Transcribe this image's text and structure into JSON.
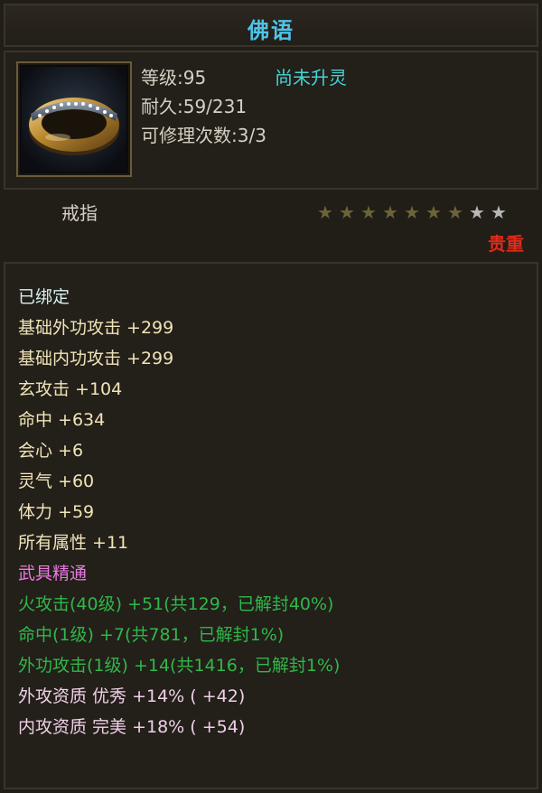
{
  "title": "佛语",
  "item": {
    "level": "等级:95",
    "durability": "耐久:59/231",
    "repairs": "可修理次数:3/3",
    "spirit_status": "尚未升灵",
    "type": "戒指",
    "rarity": "贵重",
    "stars_total": 9,
    "stars_filled": 7,
    "icon": "ring-icon"
  },
  "colors": {
    "title": "#4fc3e8",
    "spirit_status": "#44d4d8",
    "rarity": "#e02a1a",
    "star_filled": "#6b6438",
    "star_empty": "#b8b8b8",
    "attr": "#f0e4b8",
    "special": "#e87ae0",
    "mastery": "#2fb84a"
  },
  "attributes": {
    "bound": "已绑定",
    "lines": [
      "基础外功攻击 +299",
      "基础内功攻击 +299",
      "玄攻击 +104",
      "命中 +634",
      "会心 +6",
      "灵气 +60",
      "体力 +59",
      "所有属性 +11"
    ],
    "special_title": "武具精通",
    "mastery": [
      "火攻击(40级) +51(共129，已解封40%)",
      "命中(1级) +7(共781，已解封1%)",
      "外功攻击(1级) +14(共1416，已解封1%)"
    ],
    "quality": [
      "外攻资质  优秀 +14% ( +42)",
      "内攻资质  完美 +18% ( +54)"
    ]
  }
}
